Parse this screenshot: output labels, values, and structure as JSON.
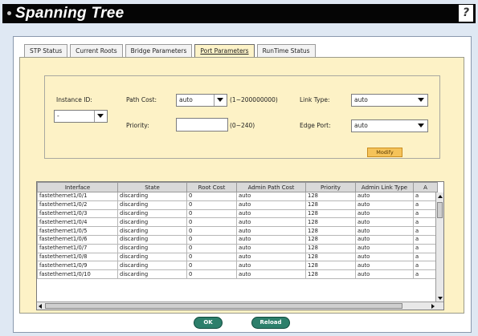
{
  "header": {
    "title": "Spanning Tree",
    "help_icon": "help-icon"
  },
  "tabs": [
    {
      "label": "STP Status",
      "active": false
    },
    {
      "label": "Current Roots",
      "active": false
    },
    {
      "label": "Bridge Parameters",
      "active": false
    },
    {
      "label": "Port Parameters",
      "active": true
    },
    {
      "label": "RunTime Status",
      "active": false
    }
  ],
  "form": {
    "instance_label": "Instance ID:",
    "instance_value": "-",
    "path_cost_label": "Path Cost:",
    "path_cost_value": "auto",
    "path_cost_hint": "(1~200000000)",
    "priority_label": "Priority:",
    "priority_value": "",
    "priority_hint": "(0~240)",
    "link_type_label": "Link Type:",
    "link_type_value": "auto",
    "edge_port_label": "Edge Port:",
    "edge_port_value": "auto",
    "modify_label": "Modify"
  },
  "table": {
    "columns": [
      "Interface",
      "State",
      "Root Cost",
      "Admin Path Cost",
      "Priority",
      "Admin Link Type",
      "A"
    ],
    "rows": [
      [
        "fastethernet1/0/1",
        "discarding",
        "0",
        "auto",
        "128",
        "auto",
        "a"
      ],
      [
        "fastethernet1/0/2",
        "discarding",
        "0",
        "auto",
        "128",
        "auto",
        "a"
      ],
      [
        "fastethernet1/0/3",
        "discarding",
        "0",
        "auto",
        "128",
        "auto",
        "a"
      ],
      [
        "fastethernet1/0/4",
        "discarding",
        "0",
        "auto",
        "128",
        "auto",
        "a"
      ],
      [
        "fastethernet1/0/5",
        "discarding",
        "0",
        "auto",
        "128",
        "auto",
        "a"
      ],
      [
        "fastethernet1/0/6",
        "discarding",
        "0",
        "auto",
        "128",
        "auto",
        "a"
      ],
      [
        "fastethernet1/0/7",
        "discarding",
        "0",
        "auto",
        "128",
        "auto",
        "a"
      ],
      [
        "fastethernet1/0/8",
        "discarding",
        "0",
        "auto",
        "128",
        "auto",
        "a"
      ],
      [
        "fastethernet1/0/9",
        "discarding",
        "0",
        "auto",
        "128",
        "auto",
        "a"
      ],
      [
        "fastethernet1/0/10",
        "discarding",
        "0",
        "auto",
        "128",
        "auto",
        "a"
      ]
    ]
  },
  "buttons": {
    "ok_label": "OK",
    "reload_label": "Reload"
  },
  "colors": {
    "titlebar": "#050505",
    "panel": "#fdf2c6",
    "button": "#2d7f6b",
    "modify": "#f5c35a"
  }
}
